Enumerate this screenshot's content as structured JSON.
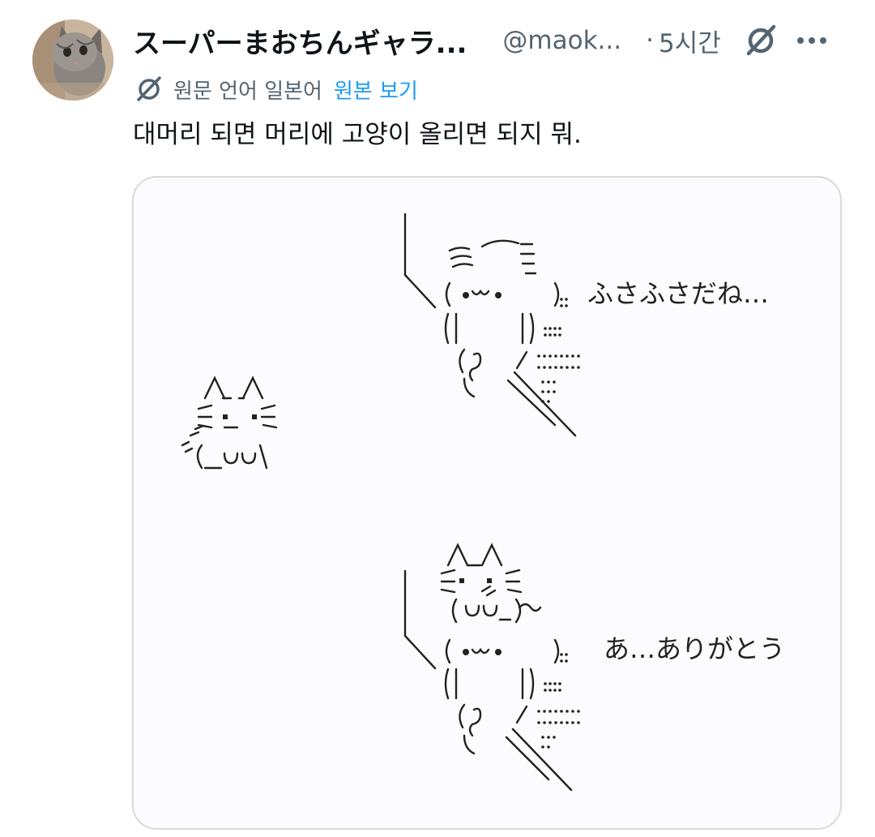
{
  "author": {
    "display_name": "スーパーまおちんギャラ...",
    "handle": "@maok...",
    "separator": "·",
    "timestamp": "5시간",
    "avatar_icon": "cat-photo-avatar",
    "grok_icon": "grok-icon",
    "more_icon": "more-dots-icon"
  },
  "translation": {
    "icon": "grok-translate-icon",
    "label": "원문 언어 일본어",
    "view_original": "원본 보기"
  },
  "tweet": {
    "text": "대머리 되면 머리에 고양이 올리면 되지 뭐."
  },
  "media": {
    "caption_top": "ふさふさだね…",
    "caption_bottom": "あ…ありがとう"
  },
  "colors": {
    "link": "#1d9bf0",
    "secondary_text": "#536471",
    "border": "#d5dbe0"
  }
}
